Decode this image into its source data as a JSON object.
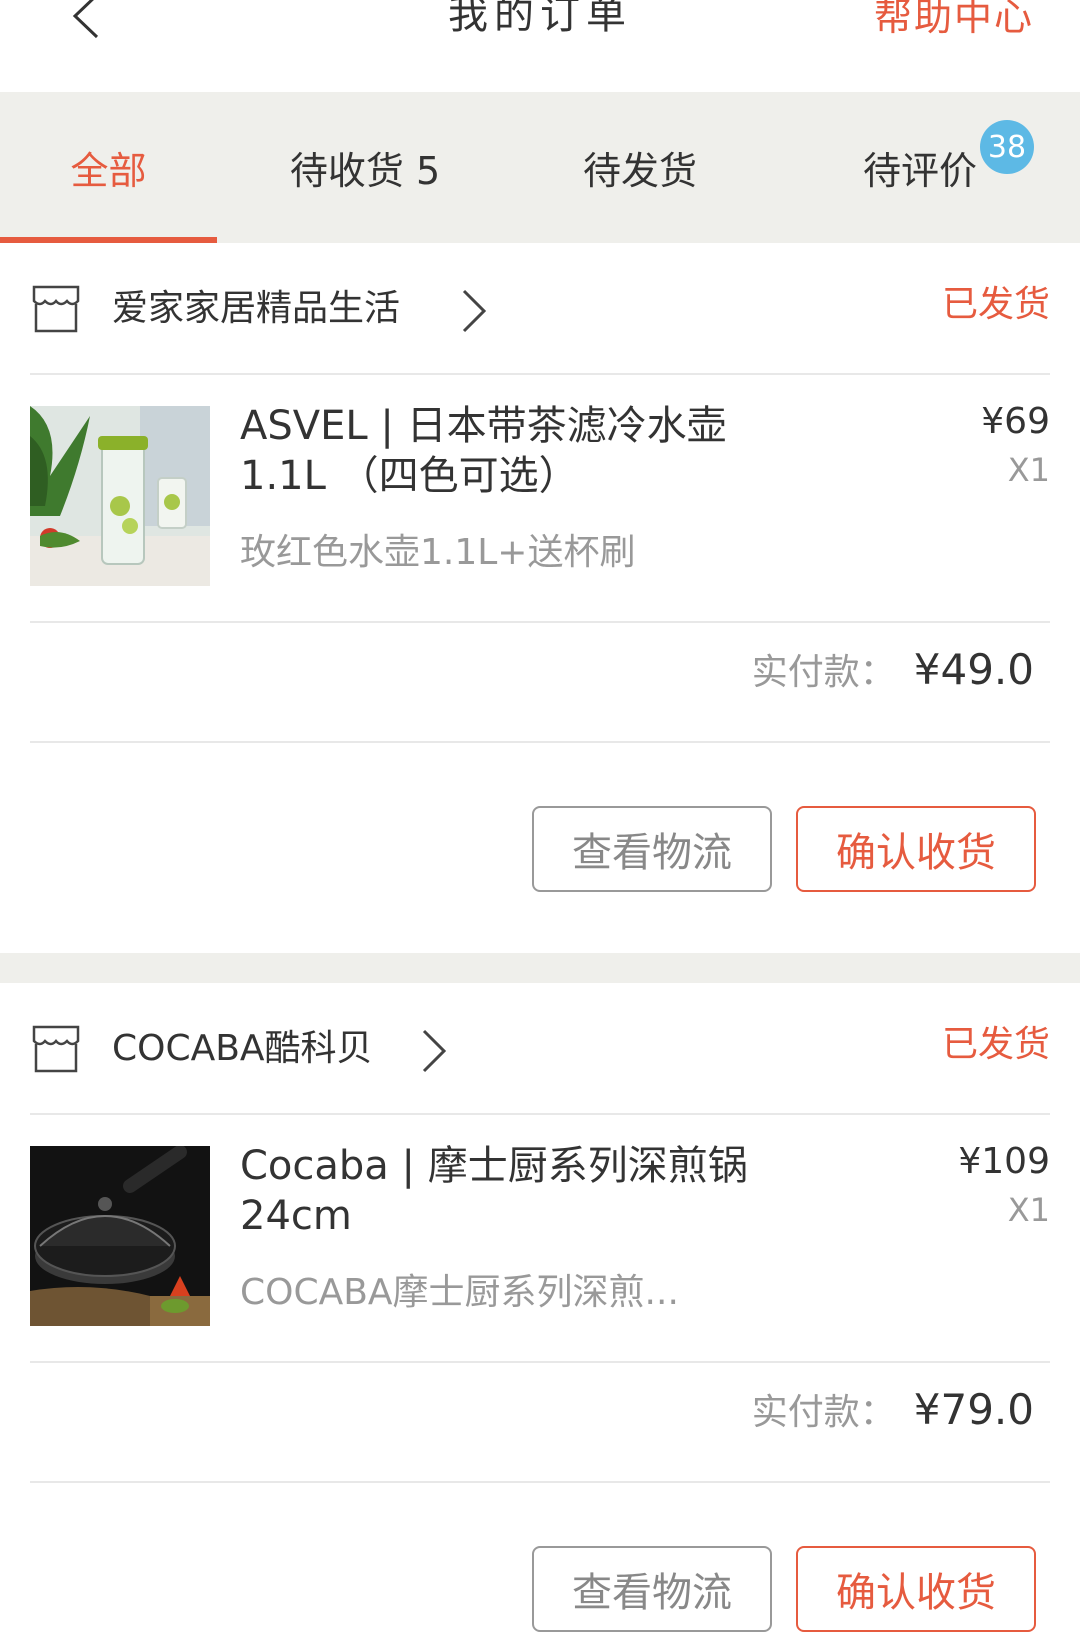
{
  "colors": {
    "accent": "#e65b3f",
    "badge": "#5db9e5",
    "tabbar_bg": "#efefeb"
  },
  "header": {
    "back_icon": "chevron-left-icon",
    "title": "我的订单",
    "help": "帮助中心"
  },
  "tabs": [
    {
      "label": "全部",
      "active": true
    },
    {
      "label": "待收货 5"
    },
    {
      "label": "待发货"
    },
    {
      "label": "待评价",
      "badge": "38"
    }
  ],
  "orders": [
    {
      "shop_icon": "store-icon",
      "shop_name": "爱家家居精品生活",
      "status": "已发货",
      "product_name": "ASVEL | 日本带茶滤冷水壶1.1L （四色可选）",
      "variant": "玫红色水壶1.1L+送杯刷",
      "price": "¥69",
      "qty": "X1",
      "paid_label": "实付款：",
      "paid_amount": "¥49.0",
      "btn_logistics": "查看物流",
      "btn_confirm": "确认收货"
    },
    {
      "shop_icon": "store-icon",
      "shop_name": "COCABA酷科贝",
      "status": "已发货",
      "product_name": "Cocaba | 摩士厨系列深煎锅 24cm",
      "variant": "COCABA摩士厨系列深煎...",
      "price": "¥109",
      "qty": "X1",
      "paid_label": "实付款：",
      "paid_amount": "¥79.0",
      "btn_logistics": "查看物流",
      "btn_confirm": "确认收货"
    }
  ]
}
